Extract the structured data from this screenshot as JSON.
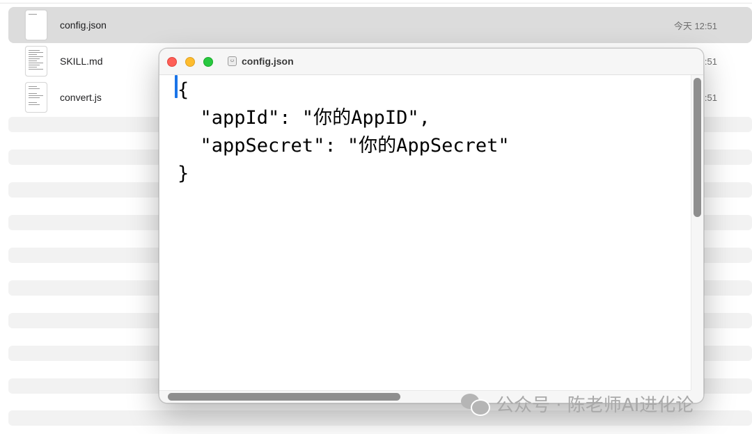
{
  "finder": {
    "files": [
      {
        "name": "config.json",
        "date": "今天 12:51",
        "selected": true
      },
      {
        "name": "SKILL.md",
        "date": "今天 12:51",
        "selected": false
      },
      {
        "name": "convert.js",
        "date": "今天 12:51",
        "selected": false
      }
    ],
    "visible_date_fragments": [
      ":51",
      ":51"
    ]
  },
  "editor": {
    "title": "config.json",
    "code_lines": [
      "{",
      "  \"appId\": \"你的AppID\",",
      "  \"appSecret\": \"你的AppSecret\"",
      "}"
    ]
  },
  "watermark": {
    "text": "公众号 · 陈老师AI进化论"
  },
  "colors": {
    "close": "#fe5f57",
    "minimize": "#febc2e",
    "maximize": "#28c840",
    "caret": "#1a74e8",
    "selected_row": "#dcdcdc"
  }
}
